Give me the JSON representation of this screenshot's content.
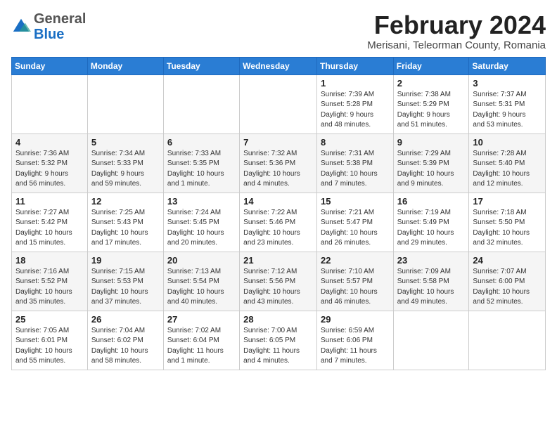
{
  "logo": {
    "general": "General",
    "blue": "Blue"
  },
  "header": {
    "month_title": "February 2024",
    "subtitle": "Merisani, Teleorman County, Romania"
  },
  "weekdays": [
    "Sunday",
    "Monday",
    "Tuesday",
    "Wednesday",
    "Thursday",
    "Friday",
    "Saturday"
  ],
  "weeks": [
    [
      {
        "day": "",
        "info": ""
      },
      {
        "day": "",
        "info": ""
      },
      {
        "day": "",
        "info": ""
      },
      {
        "day": "",
        "info": ""
      },
      {
        "day": "1",
        "info": "Sunrise: 7:39 AM\nSunset: 5:28 PM\nDaylight: 9 hours\nand 48 minutes."
      },
      {
        "day": "2",
        "info": "Sunrise: 7:38 AM\nSunset: 5:29 PM\nDaylight: 9 hours\nand 51 minutes."
      },
      {
        "day": "3",
        "info": "Sunrise: 7:37 AM\nSunset: 5:31 PM\nDaylight: 9 hours\nand 53 minutes."
      }
    ],
    [
      {
        "day": "4",
        "info": "Sunrise: 7:36 AM\nSunset: 5:32 PM\nDaylight: 9 hours\nand 56 minutes."
      },
      {
        "day": "5",
        "info": "Sunrise: 7:34 AM\nSunset: 5:33 PM\nDaylight: 9 hours\nand 59 minutes."
      },
      {
        "day": "6",
        "info": "Sunrise: 7:33 AM\nSunset: 5:35 PM\nDaylight: 10 hours\nand 1 minute."
      },
      {
        "day": "7",
        "info": "Sunrise: 7:32 AM\nSunset: 5:36 PM\nDaylight: 10 hours\nand 4 minutes."
      },
      {
        "day": "8",
        "info": "Sunrise: 7:31 AM\nSunset: 5:38 PM\nDaylight: 10 hours\nand 7 minutes."
      },
      {
        "day": "9",
        "info": "Sunrise: 7:29 AM\nSunset: 5:39 PM\nDaylight: 10 hours\nand 9 minutes."
      },
      {
        "day": "10",
        "info": "Sunrise: 7:28 AM\nSunset: 5:40 PM\nDaylight: 10 hours\nand 12 minutes."
      }
    ],
    [
      {
        "day": "11",
        "info": "Sunrise: 7:27 AM\nSunset: 5:42 PM\nDaylight: 10 hours\nand 15 minutes."
      },
      {
        "day": "12",
        "info": "Sunrise: 7:25 AM\nSunset: 5:43 PM\nDaylight: 10 hours\nand 17 minutes."
      },
      {
        "day": "13",
        "info": "Sunrise: 7:24 AM\nSunset: 5:45 PM\nDaylight: 10 hours\nand 20 minutes."
      },
      {
        "day": "14",
        "info": "Sunrise: 7:22 AM\nSunset: 5:46 PM\nDaylight: 10 hours\nand 23 minutes."
      },
      {
        "day": "15",
        "info": "Sunrise: 7:21 AM\nSunset: 5:47 PM\nDaylight: 10 hours\nand 26 minutes."
      },
      {
        "day": "16",
        "info": "Sunrise: 7:19 AM\nSunset: 5:49 PM\nDaylight: 10 hours\nand 29 minutes."
      },
      {
        "day": "17",
        "info": "Sunrise: 7:18 AM\nSunset: 5:50 PM\nDaylight: 10 hours\nand 32 minutes."
      }
    ],
    [
      {
        "day": "18",
        "info": "Sunrise: 7:16 AM\nSunset: 5:52 PM\nDaylight: 10 hours\nand 35 minutes."
      },
      {
        "day": "19",
        "info": "Sunrise: 7:15 AM\nSunset: 5:53 PM\nDaylight: 10 hours\nand 37 minutes."
      },
      {
        "day": "20",
        "info": "Sunrise: 7:13 AM\nSunset: 5:54 PM\nDaylight: 10 hours\nand 40 minutes."
      },
      {
        "day": "21",
        "info": "Sunrise: 7:12 AM\nSunset: 5:56 PM\nDaylight: 10 hours\nand 43 minutes."
      },
      {
        "day": "22",
        "info": "Sunrise: 7:10 AM\nSunset: 5:57 PM\nDaylight: 10 hours\nand 46 minutes."
      },
      {
        "day": "23",
        "info": "Sunrise: 7:09 AM\nSunset: 5:58 PM\nDaylight: 10 hours\nand 49 minutes."
      },
      {
        "day": "24",
        "info": "Sunrise: 7:07 AM\nSunset: 6:00 PM\nDaylight: 10 hours\nand 52 minutes."
      }
    ],
    [
      {
        "day": "25",
        "info": "Sunrise: 7:05 AM\nSunset: 6:01 PM\nDaylight: 10 hours\nand 55 minutes."
      },
      {
        "day": "26",
        "info": "Sunrise: 7:04 AM\nSunset: 6:02 PM\nDaylight: 10 hours\nand 58 minutes."
      },
      {
        "day": "27",
        "info": "Sunrise: 7:02 AM\nSunset: 6:04 PM\nDaylight: 11 hours\nand 1 minute."
      },
      {
        "day": "28",
        "info": "Sunrise: 7:00 AM\nSunset: 6:05 PM\nDaylight: 11 hours\nand 4 minutes."
      },
      {
        "day": "29",
        "info": "Sunrise: 6:59 AM\nSunset: 6:06 PM\nDaylight: 11 hours\nand 7 minutes."
      },
      {
        "day": "",
        "info": ""
      },
      {
        "day": "",
        "info": ""
      }
    ]
  ]
}
